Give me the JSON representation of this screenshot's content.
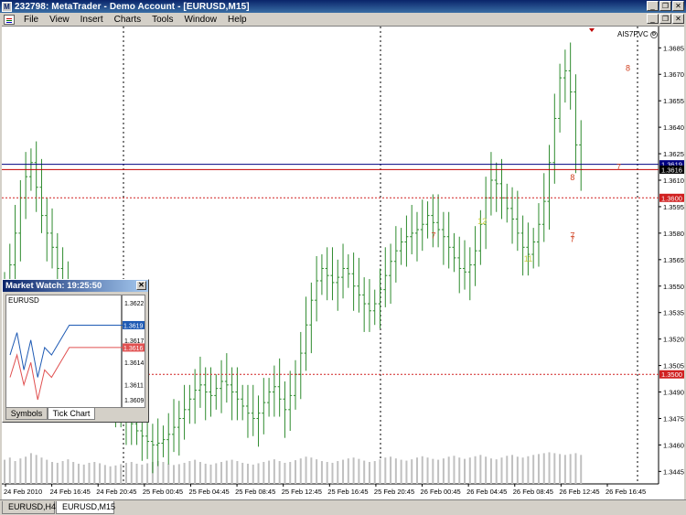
{
  "window": {
    "title": "232798: MetaTrader - Demo Account - [EURUSD,M15]",
    "app_icon": "metatrader-icon",
    "controls": [
      "minimize",
      "restore",
      "close"
    ]
  },
  "menu": {
    "items": [
      "File",
      "View",
      "Insert",
      "Charts",
      "Tools",
      "Window",
      "Help"
    ]
  },
  "chart": {
    "indicator_label": "AIS7PVC",
    "colors": {
      "bull": "#2e8b2e",
      "bear": "#2e8b2e",
      "bid_line": "#000080",
      "ask_line": "#c00000",
      "level_line": "#d02020",
      "volume": "#c0c0c0"
    }
  },
  "chart_data": {
    "type": "bar",
    "symbol": "EURUSD",
    "timeframe": "M15",
    "y_ticks": [
      "1.3685",
      "1.3670",
      "1.3655",
      "1.3640",
      "1.3625",
      "1.3610",
      "1.3595",
      "1.3580",
      "1.3565",
      "1.3550",
      "1.3535",
      "1.3520",
      "1.3505",
      "1.3490",
      "1.3475",
      "1.3460",
      "1.3445"
    ],
    "x_ticks": [
      "24 Feb 2010",
      "24 Feb 16:45",
      "24 Feb 20:45",
      "25 Feb 00:45",
      "25 Feb 04:45",
      "25 Feb 08:45",
      "25 Feb 12:45",
      "25 Feb 16:45",
      "25 Feb 20:45",
      "26 Feb 00:45",
      "26 Feb 04:45",
      "26 Feb 08:45",
      "26 Feb 12:45",
      "26 Feb 16:45"
    ],
    "ylim": [
      1.344,
      1.3695
    ],
    "price_labels": [
      {
        "value": "1.3619",
        "role": "bid"
      },
      {
        "value": "1.3616",
        "role": "ask"
      },
      {
        "value": "1.3600",
        "role": "level"
      },
      {
        "value": "1.3500",
        "role": "level"
      }
    ],
    "levels": [
      1.36,
      1.35
    ],
    "bid": 1.3619,
    "ask": 1.3616,
    "markers": [
      {
        "label": "8",
        "x_tick": "26 Feb 16:45",
        "value": 1.3672,
        "color": "#d04020"
      },
      {
        "label": "8",
        "x_tick": "26 Feb 12:45",
        "value": 1.361,
        "color": "#d04020"
      },
      {
        "label": "7",
        "x_tick": "26 Feb 16:45",
        "value": 1.3616,
        "color": "#d04020"
      },
      {
        "label": "7",
        "x_tick": "26 Feb 00:45",
        "value": 1.3577,
        "color": "#d04020"
      },
      {
        "label": "7",
        "x_tick": "26 Feb 12:45",
        "value": 1.3575,
        "color": "#d04020"
      },
      {
        "label": "7",
        "x_tick": "26 Feb 12:45",
        "value": 1.3577,
        "color": "#d04020"
      },
      {
        "label": "12",
        "x_tick": "26 Feb 04:45",
        "value": 1.3585,
        "color": "#c8d040"
      },
      {
        "label": "11",
        "x_tick": "26 Feb 08:45",
        "value": 1.3564,
        "color": "#c8d040"
      }
    ],
    "series": [
      {
        "values": [
          1.355,
          1.3562,
          1.358,
          1.36,
          1.3612,
          1.362,
          1.3606,
          1.359,
          1.358,
          1.3572,
          1.356,
          1.3548,
          1.353,
          1.352,
          1.351,
          1.3505,
          1.35,
          1.3497,
          1.3493,
          1.349,
          1.3487,
          1.3484,
          1.348,
          1.3476,
          1.3472,
          1.3468,
          1.3465,
          1.3462,
          1.346,
          1.3461,
          1.3463,
          1.3466,
          1.347,
          1.3475,
          1.348,
          1.3486,
          1.3491,
          1.3494,
          1.349,
          1.3488,
          1.3492,
          1.3496,
          1.3494,
          1.349,
          1.3486,
          1.3482,
          1.3478,
          1.3475,
          1.3478,
          1.3484,
          1.349,
          1.3493,
          1.3486,
          1.348,
          1.3488,
          1.35,
          1.3512,
          1.3528,
          1.3542,
          1.3553,
          1.356,
          1.3556,
          1.3552,
          1.3555,
          1.356,
          1.3557,
          1.355,
          1.3545,
          1.354,
          1.3536,
          1.354,
          1.3548,
          1.3556,
          1.3564,
          1.357,
          1.3575,
          1.3578,
          1.358,
          1.3582,
          1.3585,
          1.359,
          1.3586,
          1.3582,
          1.3578,
          1.3572,
          1.3566,
          1.356,
          1.3558,
          1.3562,
          1.357,
          1.3585,
          1.36,
          1.361,
          1.3608,
          1.36,
          1.3594,
          1.3588,
          1.358,
          1.3572,
          1.3568,
          1.3575,
          1.3585,
          1.3598,
          1.362,
          1.3645,
          1.3668,
          1.3672,
          1.366,
          1.363,
          1.3616
        ]
      }
    ],
    "volume": [
      0.55,
      0.6,
      0.52,
      0.58,
      0.62,
      0.7,
      0.66,
      0.6,
      0.55,
      0.5,
      0.48,
      0.52,
      0.56,
      0.5,
      0.46,
      0.44,
      0.48,
      0.5,
      0.47,
      0.43,
      0.4,
      0.42,
      0.45,
      0.48,
      0.5,
      0.46,
      0.44,
      0.47,
      0.5,
      0.52,
      0.5,
      0.46,
      0.43,
      0.45,
      0.48,
      0.52,
      0.55,
      0.5,
      0.46,
      0.44,
      0.47,
      0.5,
      0.53,
      0.55,
      0.52,
      0.48,
      0.46,
      0.44,
      0.47,
      0.5,
      0.53,
      0.56,
      0.52,
      0.48,
      0.5,
      0.54,
      0.58,
      0.62,
      0.6,
      0.56,
      0.52,
      0.5,
      0.48,
      0.52,
      0.55,
      0.58,
      0.6,
      0.57,
      0.53,
      0.5,
      0.52,
      0.56,
      0.6,
      0.62,
      0.58,
      0.55,
      0.53,
      0.56,
      0.6,
      0.63,
      0.6,
      0.57,
      0.55,
      0.58,
      0.62,
      0.64,
      0.6,
      0.57,
      0.6,
      0.63,
      0.66,
      0.62,
      0.58,
      0.56,
      0.6,
      0.64,
      0.66,
      0.62,
      0.6,
      0.63,
      0.66,
      0.68,
      0.7,
      0.72,
      0.7,
      0.68,
      0.66,
      0.68,
      0.7,
      0.66
    ]
  },
  "market_watch": {
    "title": "Market Watch: 19:25:50",
    "symbol": "EURUSD",
    "y_ticks": [
      "1.3622",
      "1.3619",
      "1.3617",
      "1.3616",
      "1.3614",
      "1.3611",
      "1.3609"
    ],
    "bid": "1.3619",
    "ask": "1.3616",
    "tabs": [
      "Symbols",
      "Tick Chart"
    ],
    "active_tab": "Tick Chart",
    "bid_ticks": [
      1.3615,
      1.3618,
      1.3613,
      1.3617,
      1.3612,
      1.3616,
      1.3615,
      1.3619,
      1.3619,
      1.3619,
      1.3619,
      1.3619,
      1.3619
    ],
    "ask_ticks": [
      1.3612,
      1.3615,
      1.3611,
      1.3614,
      1.3609,
      1.3613,
      1.3612,
      1.3616,
      1.3616,
      1.3616,
      1.3616,
      1.3616,
      1.3616
    ]
  },
  "tabs": {
    "items": [
      "EURUSD,H4",
      "EURUSD,M15"
    ],
    "active": "EURUSD,M15"
  }
}
